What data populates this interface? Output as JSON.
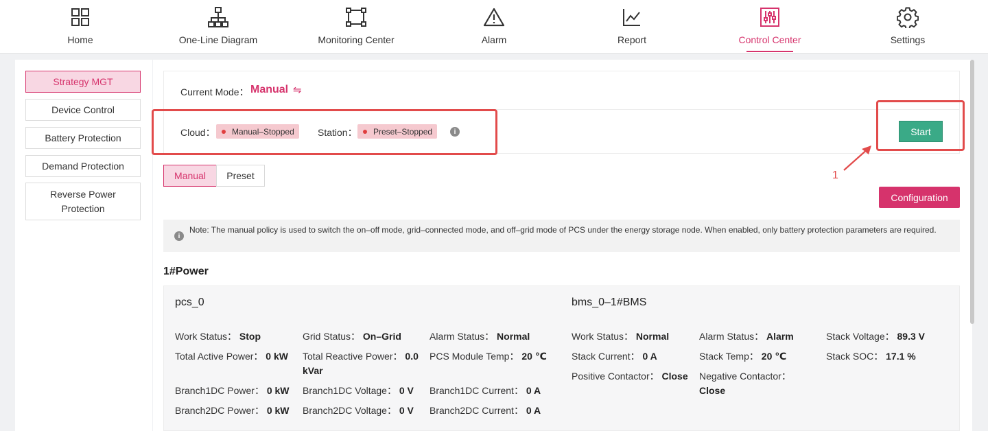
{
  "nav": {
    "items": [
      {
        "label": "Home",
        "icon": "grid-icon"
      },
      {
        "label": "One-Line Diagram",
        "icon": "hierarchy-icon"
      },
      {
        "label": "Monitoring Center",
        "icon": "monitor-frame-icon"
      },
      {
        "label": "Alarm",
        "icon": "warning-icon"
      },
      {
        "label": "Report",
        "icon": "line-chart-icon"
      },
      {
        "label": "Control Center",
        "icon": "sliders-icon"
      },
      {
        "label": "Settings",
        "icon": "gear-icon"
      }
    ],
    "active": "Control Center",
    "accent_color": "#d6336c"
  },
  "sidebar": {
    "items": [
      {
        "label": "Strategy MGT"
      },
      {
        "label": "Device Control"
      },
      {
        "label": "Battery Protection"
      },
      {
        "label": "Demand Protection"
      },
      {
        "label": "Reverse Power Protection"
      }
    ],
    "active": "Strategy MGT"
  },
  "mode": {
    "label": "Current Mode：",
    "value": "Manual",
    "swap_glyph": "⇋"
  },
  "status": {
    "cloud_label": "Cloud：",
    "cloud_value": "Manual–Stopped",
    "station_label": "Station：",
    "station_value": "Preset–Stopped",
    "info_glyph": "i"
  },
  "actions": {
    "start_label": "Start",
    "start_color": "#3aaa87",
    "configuration_label": "Configuration"
  },
  "tabs": [
    {
      "label": "Manual"
    },
    {
      "label": "Preset"
    }
  ],
  "annotation": {
    "step_number": "1",
    "color": "#e24b4b"
  },
  "note": {
    "info_glyph": "i",
    "text": "Note: The manual policy is used to switch the on–off mode, grid–connected mode, and off–grid mode of PCS under the energy storage node. When enabled, only battery protection parameters are required."
  },
  "power": {
    "title": "1#Power",
    "pcs": {
      "name": "pcs_0",
      "fields": [
        {
          "label": "Work Status：",
          "value": "Stop"
        },
        {
          "label": "Grid Status：",
          "value": "On–Grid"
        },
        {
          "label": "Alarm Status：",
          "value": "Normal"
        },
        {
          "label": "Total Active Power：",
          "value": "0 kW"
        },
        {
          "label": "Total Reactive Power：",
          "value": "0.0 kVar"
        },
        {
          "label": "PCS Module Temp：",
          "value": "20 ℃"
        },
        {
          "label": "Branch1DC Power：",
          "value": "0 kW"
        },
        {
          "label": "Branch1DC Voltage：",
          "value": "0 V"
        },
        {
          "label": "Branch1DC Current：",
          "value": "0 A"
        },
        {
          "label": "Branch2DC Power：",
          "value": "0 kW"
        },
        {
          "label": "Branch2DC Voltage：",
          "value": "0 V"
        },
        {
          "label": "Branch2DC Current：",
          "value": "0 A"
        }
      ]
    },
    "bms": {
      "name": "bms_0–1#BMS",
      "fields": [
        {
          "label": "Work Status：",
          "value": "Normal"
        },
        {
          "label": "Alarm Status：",
          "value": "Alarm"
        },
        {
          "label": "Stack Voltage：",
          "value": "89.3 V"
        },
        {
          "label": "Stack Current：",
          "value": "0 A"
        },
        {
          "label": "Stack Temp：",
          "value": "20 ℃"
        },
        {
          "label": "Stack SOC：",
          "value": "17.1 %"
        },
        {
          "label": "Positive Contactor：",
          "value": "Close"
        },
        {
          "label": "Negative Contactor：",
          "value": "Close"
        }
      ]
    }
  }
}
